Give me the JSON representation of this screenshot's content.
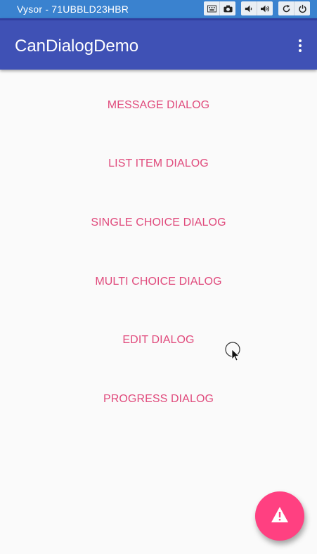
{
  "window": {
    "title": "Vysor - 71UBBLD23HBR",
    "controls": [
      "keyboard-icon",
      "camera-icon",
      "volume-down-icon",
      "volume-up-icon",
      "rotate-icon",
      "power-icon"
    ]
  },
  "appbar": {
    "title": "CanDialogDemo",
    "overflow_icon": "more-vert-icon"
  },
  "buttons": [
    {
      "label": "MESSAGE DIALOG"
    },
    {
      "label": "LIST ITEM DIALOG"
    },
    {
      "label": "SINGLE CHOICE DIALOG"
    },
    {
      "label": "MULTI CHOICE DIALOG"
    },
    {
      "label": "EDIT DIALOG"
    },
    {
      "label": "PROGRESS DIALOG"
    }
  ],
  "fab": {
    "icon": "warning-icon"
  },
  "colors": {
    "primary": "#3f51b5",
    "accent": "#ff4081",
    "button_text": "#e04a7c",
    "background": "#fafafa"
  }
}
